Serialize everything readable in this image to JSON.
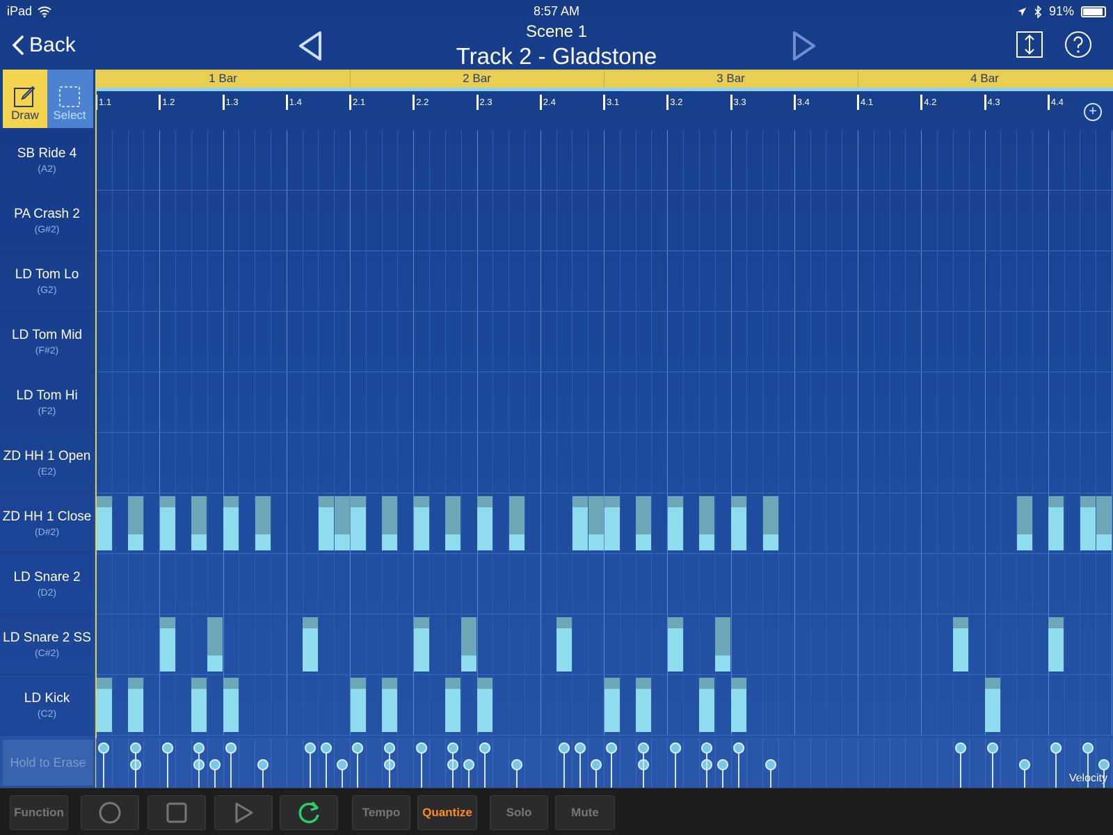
{
  "status_bar": {
    "device": "iPad",
    "time": "8:57 AM",
    "battery": "91%"
  },
  "nav": {
    "back_label": "Back",
    "scene": "Scene  1",
    "track": "Track 2 - Gladstone"
  },
  "tools": {
    "draw_label": "Draw",
    "select_label": "Select",
    "active": "draw"
  },
  "bars": [
    "1 Bar",
    "2 Bar",
    "3 Bar",
    "4 Bar"
  ],
  "beats": [
    "1.1",
    "1.2",
    "1.3",
    "1.4",
    "2.1",
    "2.2",
    "2.3",
    "2.4",
    "3.1",
    "3.2",
    "3.3",
    "3.4",
    "4.1",
    "4.2",
    "4.3",
    "4.4"
  ],
  "lanes": [
    {
      "name": "SB Ride 4",
      "key": "(A2)"
    },
    {
      "name": "PA Crash 2",
      "key": "(G#2)"
    },
    {
      "name": "LD Tom Lo",
      "key": "(G2)"
    },
    {
      "name": "LD Tom Mid",
      "key": "(F#2)"
    },
    {
      "name": "LD Tom Hi",
      "key": "(F2)"
    },
    {
      "name": "ZD HH 1 Open",
      "key": "(E2)"
    },
    {
      "name": "ZD HH 1 Close",
      "key": "(D#2)"
    },
    {
      "name": "LD Snare 2",
      "key": "(D2)"
    },
    {
      "name": "LD Snare 2 SS",
      "key": "(C#2)"
    },
    {
      "name": "LD Kick",
      "key": "(C2)"
    }
  ],
  "notes": [
    {
      "lane": 6,
      "step": 0,
      "velocity": 0.8
    },
    {
      "lane": 6,
      "step": 2,
      "velocity": 0.3
    },
    {
      "lane": 6,
      "step": 4,
      "velocity": 0.8
    },
    {
      "lane": 6,
      "step": 6,
      "velocity": 0.3
    },
    {
      "lane": 6,
      "step": 8,
      "velocity": 0.8
    },
    {
      "lane": 6,
      "step": 10,
      "velocity": 0.3
    },
    {
      "lane": 6,
      "step": 14,
      "velocity": 0.8
    },
    {
      "lane": 6,
      "step": 15,
      "velocity": 0.3
    },
    {
      "lane": 6,
      "step": 16,
      "velocity": 0.8
    },
    {
      "lane": 6,
      "step": 18,
      "velocity": 0.3
    },
    {
      "lane": 6,
      "step": 20,
      "velocity": 0.8
    },
    {
      "lane": 6,
      "step": 22,
      "velocity": 0.3
    },
    {
      "lane": 6,
      "step": 24,
      "velocity": 0.8
    },
    {
      "lane": 6,
      "step": 26,
      "velocity": 0.3
    },
    {
      "lane": 6,
      "step": 30,
      "velocity": 0.8
    },
    {
      "lane": 6,
      "step": 31,
      "velocity": 0.3
    },
    {
      "lane": 6,
      "step": 32,
      "velocity": 0.8
    },
    {
      "lane": 6,
      "step": 34,
      "velocity": 0.3
    },
    {
      "lane": 6,
      "step": 36,
      "velocity": 0.8
    },
    {
      "lane": 6,
      "step": 38,
      "velocity": 0.3
    },
    {
      "lane": 6,
      "step": 40,
      "velocity": 0.8
    },
    {
      "lane": 6,
      "step": 42,
      "velocity": 0.3
    },
    {
      "lane": 6,
      "step": 58,
      "velocity": 0.3
    },
    {
      "lane": 6,
      "step": 60,
      "velocity": 0.8
    },
    {
      "lane": 6,
      "step": 62,
      "velocity": 0.8
    },
    {
      "lane": 6,
      "step": 63,
      "velocity": 0.3
    },
    {
      "lane": 8,
      "step": 4,
      "velocity": 0.8
    },
    {
      "lane": 8,
      "step": 7,
      "velocity": 0.3
    },
    {
      "lane": 8,
      "step": 13,
      "velocity": 0.8
    },
    {
      "lane": 8,
      "step": 20,
      "velocity": 0.8
    },
    {
      "lane": 8,
      "step": 23,
      "velocity": 0.3
    },
    {
      "lane": 8,
      "step": 29,
      "velocity": 0.8
    },
    {
      "lane": 8,
      "step": 36,
      "velocity": 0.8
    },
    {
      "lane": 8,
      "step": 39,
      "velocity": 0.3
    },
    {
      "lane": 8,
      "step": 54,
      "velocity": 0.8
    },
    {
      "lane": 8,
      "step": 60,
      "velocity": 0.8
    },
    {
      "lane": 9,
      "step": 0,
      "velocity": 0.8
    },
    {
      "lane": 9,
      "step": 2,
      "velocity": 0.8
    },
    {
      "lane": 9,
      "step": 6,
      "velocity": 0.8
    },
    {
      "lane": 9,
      "step": 8,
      "velocity": 0.8
    },
    {
      "lane": 9,
      "step": 16,
      "velocity": 0.8
    },
    {
      "lane": 9,
      "step": 18,
      "velocity": 0.8
    },
    {
      "lane": 9,
      "step": 22,
      "velocity": 0.8
    },
    {
      "lane": 9,
      "step": 24,
      "velocity": 0.8
    },
    {
      "lane": 9,
      "step": 32,
      "velocity": 0.8
    },
    {
      "lane": 9,
      "step": 34,
      "velocity": 0.8
    },
    {
      "lane": 9,
      "step": 38,
      "velocity": 0.8
    },
    {
      "lane": 9,
      "step": 40,
      "velocity": 0.8
    },
    {
      "lane": 9,
      "step": 56,
      "velocity": 0.8
    }
  ],
  "velocity_panel": {
    "hold_to_erase": "Hold to Erase",
    "label": "Velocity"
  },
  "toolbar": {
    "function": "Function",
    "tempo": "Tempo",
    "quantize": "Quantize",
    "solo": "Solo",
    "mute": "Mute"
  },
  "colors": {
    "accent": "#e8cf54",
    "note": "#8fdcee",
    "note_low": "#6ea7b8",
    "quantize": "#ff8c1a",
    "loop": "#2bd160"
  }
}
